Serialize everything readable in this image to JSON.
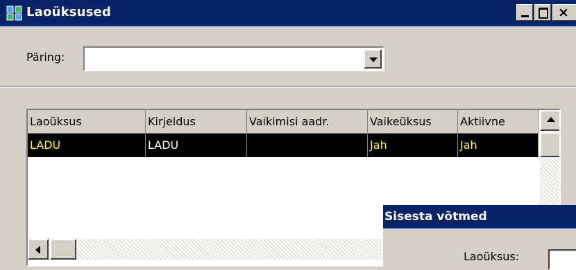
{
  "window": {
    "title": "Laoüksused",
    "icon": "app-grid-icon",
    "controls": [
      "minimize-icon",
      "maximize-icon",
      "close-icon"
    ]
  },
  "query": {
    "label": "Päring:",
    "value": ""
  },
  "table": {
    "columns": [
      "Laoüksus",
      "Kirjeldus",
      "Vaikimisi aadr.",
      "Vaikeüksus",
      "Aktiivne"
    ],
    "rows": [
      {
        "laouksus": "LADU",
        "kirjeldus": "LADU",
        "vaikimisi_aadr": "",
        "vaikeuksus": "Jah",
        "aktiivne": "Jah"
      }
    ]
  },
  "dialog": {
    "title": "Sisesta võtmed",
    "field_label": "Laoüksus:",
    "field_value": ""
  },
  "colors": {
    "titlebar": "#0a246a",
    "face": "#d4d0c8",
    "selected_row_bg": "#000000",
    "selected_row_text": "#ffff00"
  }
}
